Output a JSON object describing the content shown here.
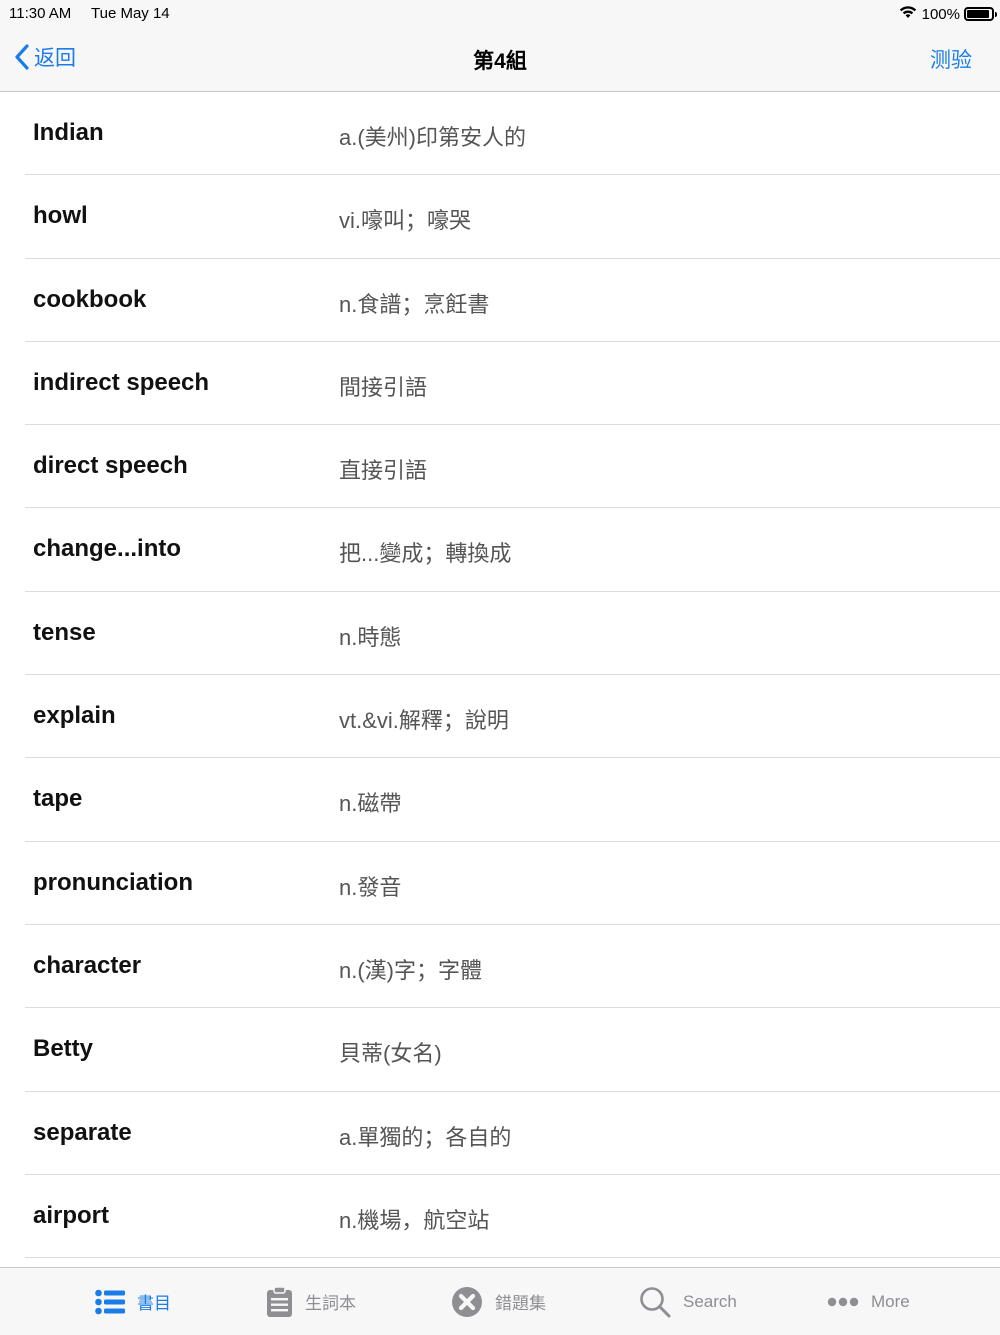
{
  "status": {
    "time": "11:30 AM",
    "date": "Tue May 14",
    "battery": "100%",
    "battery_level": 1.0
  },
  "nav": {
    "back_label": "返回",
    "title": "第4組",
    "action_label": "测验"
  },
  "words": [
    {
      "term": "Indian",
      "definition": "a.(美州)印第安人的"
    },
    {
      "term": "howl",
      "definition": "vi.嚎叫；嚎哭"
    },
    {
      "term": "cookbook",
      "definition": "n.食譜；烹飪書"
    },
    {
      "term": "indirect speech",
      "definition": "間接引語"
    },
    {
      "term": "direct speech",
      "definition": "直接引語"
    },
    {
      "term": "change...into",
      "definition": "把...變成；轉換成"
    },
    {
      "term": "tense",
      "definition": "n.時態"
    },
    {
      "term": "explain",
      "definition": "vt.&vi.解釋；說明"
    },
    {
      "term": "tape",
      "definition": "n.磁帶"
    },
    {
      "term": "pronunciation",
      "definition": "n.發音"
    },
    {
      "term": "character",
      "definition": "n.(漢)字；字體"
    },
    {
      "term": "Betty",
      "definition": "貝蒂(女名)"
    },
    {
      "term": "separate",
      "definition": "a.單獨的；各自的"
    },
    {
      "term": "airport",
      "definition": "n.機場，航空站"
    }
  ],
  "tabs": [
    {
      "label": "書目",
      "icon": "list-icon",
      "active": true
    },
    {
      "label": "生詞本",
      "icon": "clipboard-icon",
      "active": false
    },
    {
      "label": "錯題集",
      "icon": "x-circle-icon",
      "active": false
    },
    {
      "label": "Search",
      "icon": "search-icon",
      "active": false
    },
    {
      "label": "More",
      "icon": "more-icon",
      "active": false
    }
  ],
  "colors": {
    "accent": "#1a7ce8",
    "inactive": "#8e8e93",
    "bar_bg": "#f7f7f7"
  }
}
